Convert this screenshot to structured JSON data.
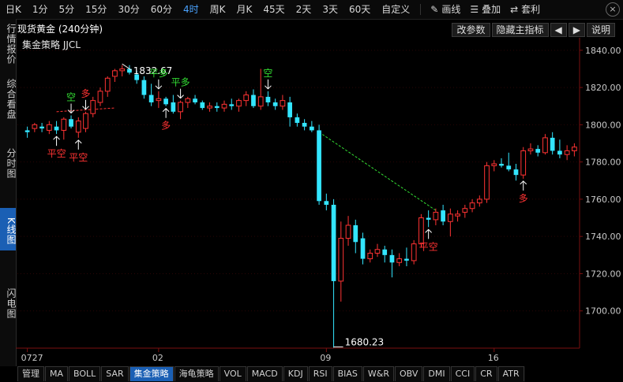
{
  "toolbar": {
    "periods": [
      "日K",
      "1分",
      "5分",
      "15分",
      "30分",
      "60分",
      "4时",
      "周K",
      "月K",
      "45天",
      "2天",
      "3天",
      "60天",
      "自定义"
    ],
    "active_period": "4时",
    "draw_label": "画线",
    "overlay_label": "叠加",
    "arbitrage_label": "套利",
    "close_symbol": "×"
  },
  "left_tabs": [
    {
      "label": "行情报价",
      "active": false
    },
    {
      "label": "综合看盘",
      "active": false
    },
    {
      "label": "分时图",
      "active": false
    },
    {
      "label": "K线图",
      "active": true
    },
    {
      "label": "闪电图",
      "active": false
    }
  ],
  "header": {
    "title": "现货黄金 (240分钟)",
    "strategy": "集金策略 JJCL",
    "buttons": {
      "edit_params": "改参数",
      "hide_indicator": "隐藏主指标",
      "prev": "◀",
      "next": "▶",
      "help": "说明"
    }
  },
  "bottom_tabs": [
    "管理",
    "MA",
    "BOLL",
    "SAR",
    "集金策略",
    "海龟策略",
    "VOL",
    "MACD",
    "KDJ",
    "RSI",
    "BIAS",
    "W&R",
    "OBV",
    "DMI",
    "CCI",
    "CR",
    "ATR"
  ],
  "active_bottom_tab": "集金策略",
  "colors": {
    "up": "#ff3333",
    "down": "#33e5ff",
    "buy_signal": "#ff3333",
    "sell_signal": "#33dd33",
    "axis": "#4a0a0a"
  },
  "chart_data": {
    "type": "candlestick",
    "ylim": [
      1680,
      1845
    ],
    "y_ticks": [
      1700,
      1720,
      1740,
      1760,
      1780,
      1800,
      1820,
      1840
    ],
    "y_tick_labels": [
      "1700.00",
      "1720.00",
      "1740.00",
      "1760.00",
      "1780.00",
      "1800.00",
      "1820.00",
      "1840.00"
    ],
    "x_labels": [
      {
        "index": 0,
        "label": "0727"
      },
      {
        "index": 18,
        "label": "02"
      },
      {
        "index": 41,
        "label": "09"
      },
      {
        "index": 64,
        "label": "16"
      }
    ],
    "candles": [
      [
        1797,
        1799,
        1793,
        1796
      ],
      [
        1798,
        1801,
        1796,
        1800
      ],
      [
        1799,
        1801,
        1796,
        1798
      ],
      [
        1797,
        1802,
        1795,
        1800
      ],
      [
        1799,
        1802,
        1795,
        1797
      ],
      [
        1797,
        1804,
        1792,
        1803
      ],
      [
        1803,
        1805,
        1798,
        1799
      ],
      [
        1796,
        1804,
        1793,
        1802
      ],
      [
        1798,
        1807,
        1796,
        1806
      ],
      [
        1806,
        1815,
        1804,
        1813
      ],
      [
        1812,
        1820,
        1810,
        1818
      ],
      [
        1818,
        1826,
        1815,
        1825
      ],
      [
        1826,
        1830,
        1823,
        1829
      ],
      [
        1829,
        1832,
        1826,
        1830
      ],
      [
        1830,
        1832,
        1827,
        1828
      ],
      [
        1827,
        1829,
        1822,
        1824
      ],
      [
        1824,
        1826,
        1814,
        1816
      ],
      [
        1816,
        1822,
        1810,
        1812
      ],
      [
        1813,
        1818,
        1809,
        1814
      ],
      [
        1814,
        1815,
        1810,
        1811
      ],
      [
        1812,
        1816,
        1806,
        1807
      ],
      [
        1807,
        1813,
        1803,
        1812
      ],
      [
        1812,
        1815,
        1809,
        1814
      ],
      [
        1814,
        1816,
        1811,
        1812
      ],
      [
        1812,
        1813,
        1808,
        1809
      ],
      [
        1809,
        1812,
        1807,
        1810
      ],
      [
        1810,
        1812,
        1807,
        1809
      ],
      [
        1809,
        1813,
        1807,
        1811
      ],
      [
        1811,
        1814,
        1808,
        1810
      ],
      [
        1810,
        1814,
        1807,
        1813
      ],
      [
        1813,
        1818,
        1810,
        1816
      ],
      [
        1816,
        1819,
        1809,
        1810
      ],
      [
        1810,
        1830,
        1808,
        1815
      ],
      [
        1815,
        1818,
        1810,
        1812
      ],
      [
        1812,
        1814,
        1808,
        1810
      ],
      [
        1810,
        1816,
        1808,
        1813
      ],
      [
        1812,
        1815,
        1799,
        1804
      ],
      [
        1804,
        1806,
        1799,
        1801
      ],
      [
        1801,
        1803,
        1797,
        1799
      ],
      [
        1799,
        1802,
        1796,
        1797
      ],
      [
        1797,
        1800,
        1757,
        1759
      ],
      [
        1759,
        1763,
        1754,
        1757
      ],
      [
        1757,
        1760,
        1680.23,
        1716
      ],
      [
        1716,
        1748,
        1705,
        1739
      ],
      [
        1739,
        1751,
        1735,
        1746
      ],
      [
        1746,
        1749,
        1731,
        1737
      ],
      [
        1739,
        1742,
        1725,
        1728
      ],
      [
        1728,
        1733,
        1726,
        1731
      ],
      [
        1731,
        1736,
        1729,
        1733
      ],
      [
        1733,
        1735,
        1726,
        1730
      ],
      [
        1730,
        1733,
        1718,
        1726
      ],
      [
        1726,
        1731,
        1724,
        1728
      ],
      [
        1728,
        1734,
        1724,
        1727
      ],
      [
        1727,
        1738,
        1725,
        1736
      ],
      [
        1736,
        1752,
        1734,
        1750
      ],
      [
        1750,
        1754,
        1745,
        1749
      ],
      [
        1749,
        1755,
        1746,
        1753
      ],
      [
        1754,
        1757,
        1746,
        1748
      ],
      [
        1748,
        1755,
        1740,
        1752
      ],
      [
        1751,
        1754,
        1748,
        1752
      ],
      [
        1753,
        1757,
        1750,
        1755
      ],
      [
        1755,
        1760,
        1753,
        1758
      ],
      [
        1758,
        1762,
        1756,
        1760
      ],
      [
        1760,
        1780,
        1758,
        1778
      ],
      [
        1778,
        1781,
        1775,
        1779
      ],
      [
        1779,
        1782,
        1777,
        1778
      ],
      [
        1778,
        1785,
        1775,
        1776
      ],
      [
        1776,
        1779,
        1770,
        1773
      ],
      [
        1773,
        1788,
        1771,
        1786
      ],
      [
        1786,
        1790,
        1784,
        1787
      ],
      [
        1787,
        1789,
        1783,
        1785
      ],
      [
        1785,
        1795,
        1784,
        1793
      ],
      [
        1793,
        1796,
        1784,
        1786
      ],
      [
        1786,
        1792,
        1782,
        1784
      ],
      [
        1784,
        1789,
        1781,
        1786
      ],
      [
        1786,
        1790,
        1783,
        1788
      ]
    ],
    "annotations": {
      "high": {
        "index": 13,
        "value": 1832.67,
        "label": "1832.67"
      },
      "low": {
        "index": 42,
        "value": 1680.23,
        "label": "1680.23"
      }
    },
    "signals": [
      {
        "index": 4,
        "label": "平空",
        "kind": "buy",
        "pos": "below"
      },
      {
        "index": 6,
        "label": "空",
        "kind": "sell",
        "pos": "above"
      },
      {
        "index": 7,
        "label": "平空",
        "kind": "buy",
        "pos": "below"
      },
      {
        "index": 8,
        "label": "多",
        "kind": "buy",
        "pos": "above"
      },
      {
        "index": 18,
        "label": "平多",
        "kind": "sell",
        "pos": "above"
      },
      {
        "index": 19,
        "label": "多",
        "kind": "buy",
        "pos": "below"
      },
      {
        "index": 21,
        "label": "平多",
        "kind": "sell",
        "pos": "above"
      },
      {
        "index": 33,
        "label": "空",
        "kind": "sell",
        "pos": "above"
      },
      {
        "index": 55,
        "label": "平空",
        "kind": "buy",
        "pos": "below"
      },
      {
        "index": 68,
        "label": "多",
        "kind": "buy",
        "pos": "below"
      }
    ],
    "trend_lines": [
      {
        "from": [
          4,
          1807
        ],
        "to": [
          12,
          1809
        ],
        "color": "#ff3333"
      },
      {
        "from": [
          40,
          1796
        ],
        "to": [
          56,
          1754
        ],
        "color": "#33dd33"
      }
    ]
  }
}
